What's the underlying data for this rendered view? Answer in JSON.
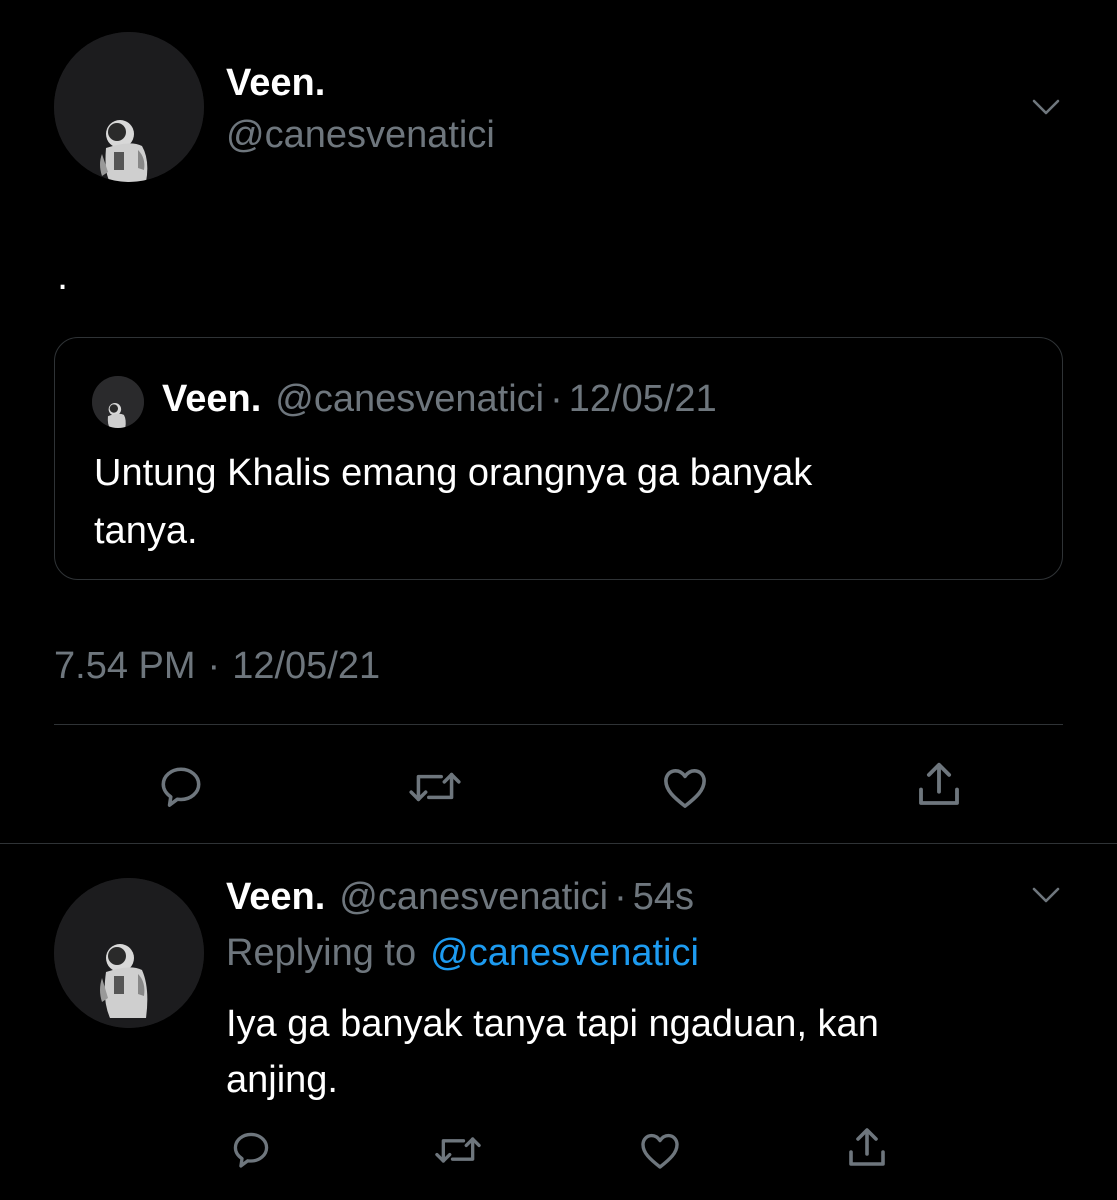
{
  "main_tweet": {
    "display_name": "Veen.",
    "handle": "@canesvenatici",
    "text": ".",
    "time": "7.54 PM",
    "date": "12/05/21",
    "separator": "·"
  },
  "quoted_tweet": {
    "display_name": "Veen.",
    "handle": "@canesvenatici",
    "separator": "·",
    "date": "12/05/21",
    "text_line1": "Untung Khalis emang orangnya ga banyak",
    "text_line2": "tanya."
  },
  "reply_tweet": {
    "display_name": "Veen.",
    "handle": "@canesvenatici",
    "separator": "·",
    "age": "54s",
    "replying_prefix": "Replying to",
    "replying_handle": "@canesvenatici",
    "text_line1": "Iya ga banyak tanya tapi ngaduan, kan",
    "text_line2": "anjing."
  },
  "icons": {
    "reply": "speech-bubble-icon",
    "retweet": "retweet-arrows-icon",
    "like": "heart-icon",
    "share": "share-upload-icon",
    "more": "chevron-down-icon",
    "avatar": "astronaut-avatar"
  },
  "colors": {
    "background": "#000000",
    "text": "#ffffff",
    "muted": "#6e767d",
    "link": "#1d9bf0",
    "border": "#2f3336"
  }
}
